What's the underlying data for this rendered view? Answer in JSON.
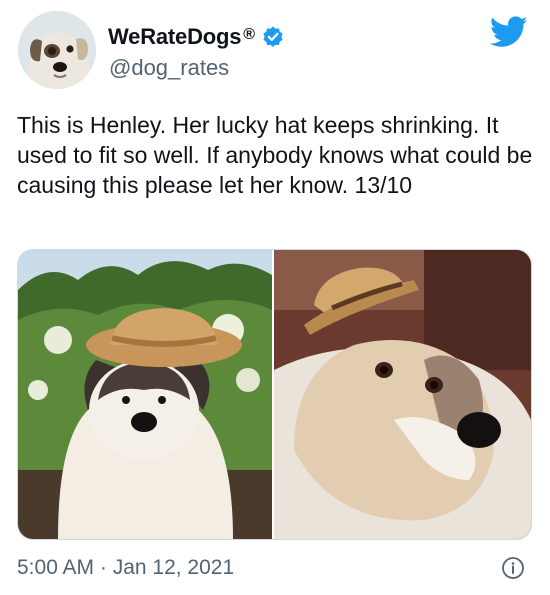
{
  "author": {
    "display_name": "WeRateDogs",
    "registered_mark": "®",
    "handle": "@dog_rates",
    "avatar_icon": "dog-face-avatar",
    "verified_icon": "verified-badge-icon"
  },
  "platform": {
    "logo_icon": "twitter-bird-icon",
    "brand_color": "#1d9bf0"
  },
  "tweet": {
    "text": "This is Henley. Her lucky hat keeps shrinking. It used to fit so well. If anybody knows what could be causing this please let her know. 13/10",
    "media": [
      {
        "kind": "photo",
        "subject": "puppy-with-straw-hat"
      },
      {
        "kind": "photo",
        "subject": "grown-dog-with-tiny-straw-hat"
      }
    ],
    "timestamp": "5:00 AM · Jan 12, 2021"
  },
  "colors": {
    "text": "#0f1419",
    "secondary": "#536471",
    "accent": "#1d9bf0"
  }
}
